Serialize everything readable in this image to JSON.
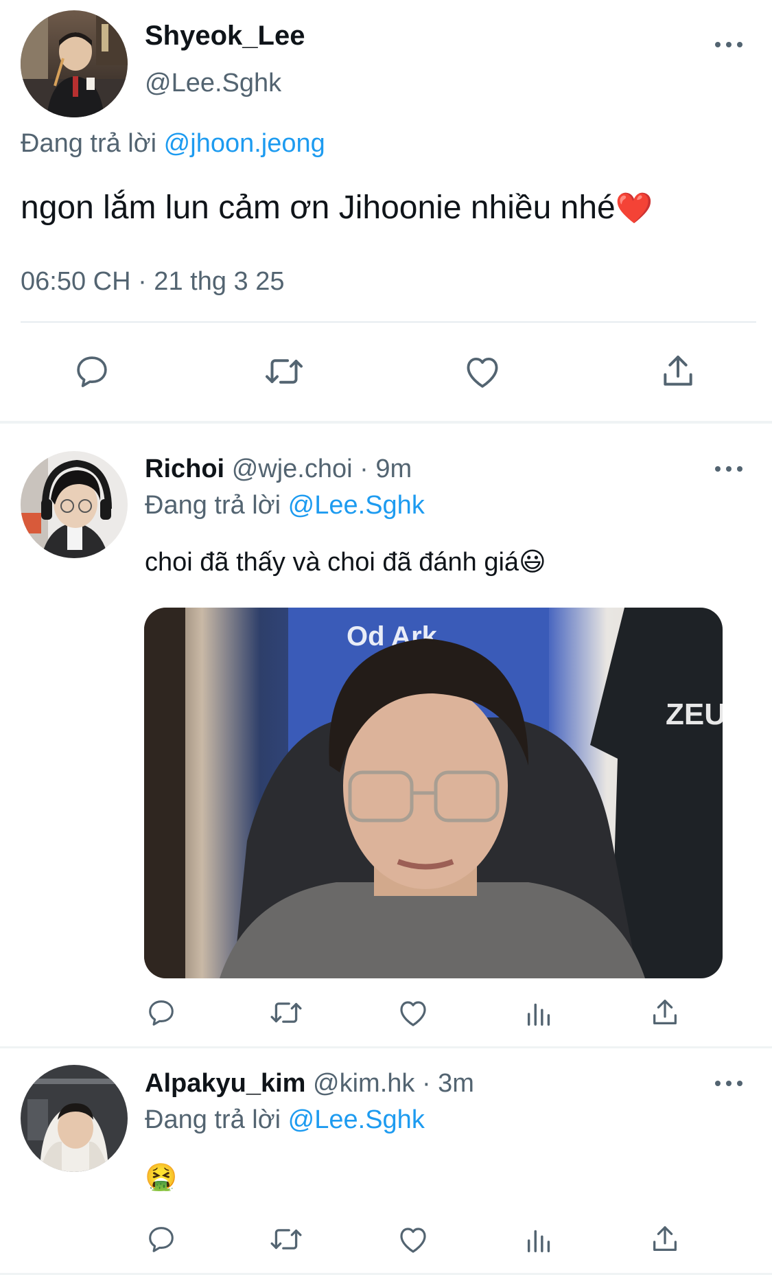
{
  "main_tweet": {
    "author_name": "Shyeok_Lee",
    "handle": "@Lee.Sghk",
    "replying_prefix": "Đang trả lời",
    "replying_to": "@jhoon.jeong",
    "text": "ngon lắm lun cảm ơn Jihoonie nhiều nhé",
    "emoji": "❤️",
    "timestamp": "06:50 CH · 21 thg 3 25",
    "actions": [
      "reply-icon",
      "retweet-icon",
      "like-icon",
      "share-icon"
    ]
  },
  "replies": [
    {
      "author_name": "Richoi",
      "handle": "@wje.choi",
      "time": "· 9m",
      "replying_prefix": "Đang trả lời",
      "replying_to": "@Lee.Sghk",
      "text": "choi đã thấy và choi đã đánh giá",
      "emoji": "😃",
      "has_media": true,
      "media_text": {
        "banner": "Od Ark",
        "jersey": "ZEU"
      },
      "actions": [
        "reply-icon",
        "retweet-icon",
        "like-icon",
        "views-icon",
        "share-icon"
      ]
    },
    {
      "author_name": "Alpakyu_kim",
      "handle": "@kim.hk",
      "time": "· 3m",
      "replying_prefix": "Đang trả lời",
      "replying_to": "@Lee.Sghk",
      "text": "",
      "emoji": "🤮",
      "actions": [
        "reply-icon",
        "retweet-icon",
        "like-icon",
        "views-icon",
        "share-icon"
      ]
    }
  ],
  "colors": {
    "link_blue": "#1d9bf0",
    "text_gray": "#536471",
    "text_dark": "#0f1419",
    "heart_red": "#e0245e"
  }
}
